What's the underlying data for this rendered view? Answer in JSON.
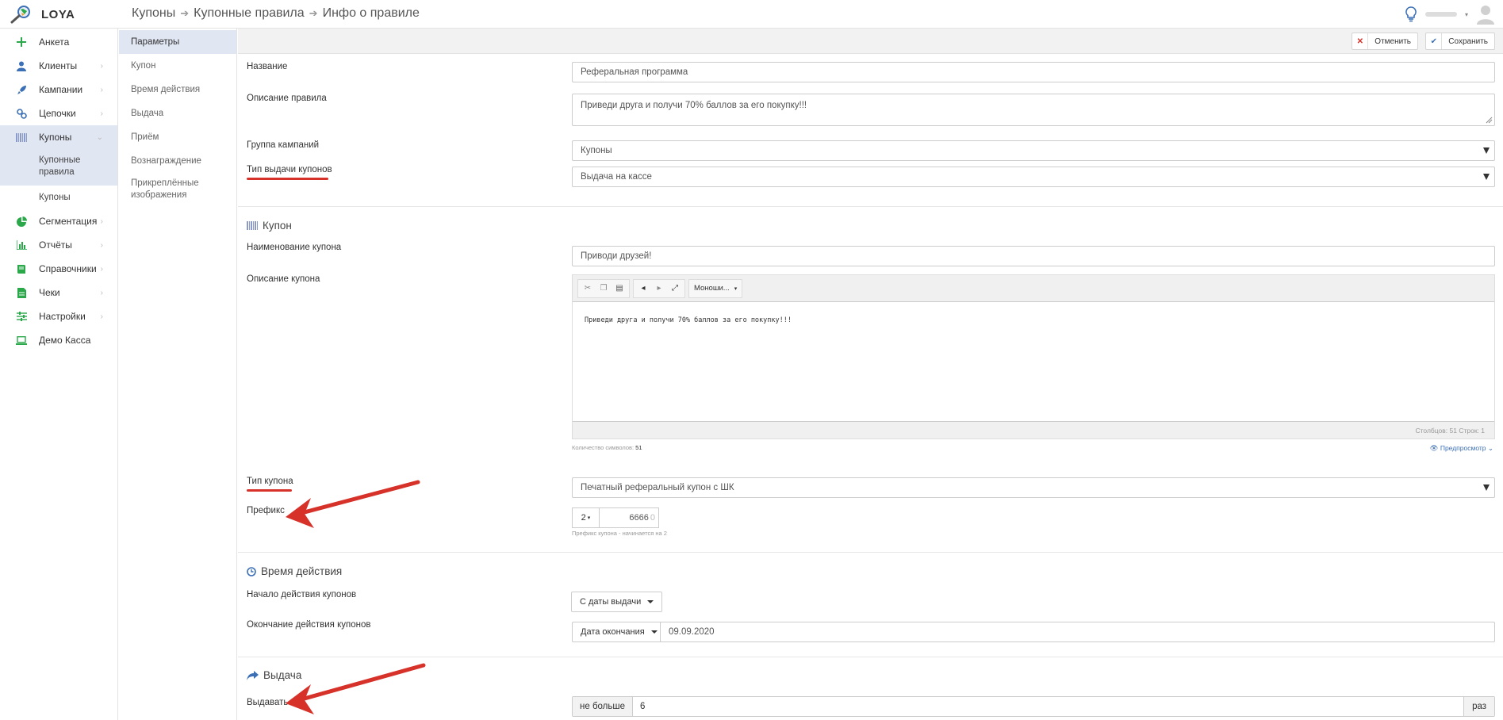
{
  "app": {
    "logo_text": "LOYA"
  },
  "breadcrumbs": [
    "Купоны",
    "Купонные правила",
    "Инфо о правиле"
  ],
  "sidebar": {
    "items": [
      {
        "label": "Анкета",
        "icon": "plus-icon",
        "color": "#2aa84a",
        "chevron": false
      },
      {
        "label": "Клиенты",
        "icon": "user-icon",
        "color": "#3b6fb6",
        "chevron": true
      },
      {
        "label": "Кампании",
        "icon": "rocket-icon",
        "color": "#3b6fb6",
        "chevron": true
      },
      {
        "label": "Цепочки",
        "icon": "chain-icon",
        "color": "#3b6fb6",
        "chevron": true
      },
      {
        "label": "Купоны",
        "icon": "barcode-icon",
        "color": "#8a9bc9",
        "chevron": true,
        "active": true
      },
      {
        "label": "Сегментация",
        "icon": "pie-icon",
        "color": "#2aa84a",
        "chevron": true
      },
      {
        "label": "Отчёты",
        "icon": "bar-chart-icon",
        "color": "#2aa84a",
        "chevron": true
      },
      {
        "label": "Справочники",
        "icon": "book-icon",
        "color": "#2aa84a",
        "chevron": true
      },
      {
        "label": "Чеки",
        "icon": "receipt-icon",
        "color": "#2aa84a",
        "chevron": true
      },
      {
        "label": "Настройки",
        "icon": "sliders-icon",
        "color": "#2aa84a",
        "chevron": true
      },
      {
        "label": "Демо Касса",
        "icon": "laptop-icon",
        "color": "#2aa84a",
        "chevron": false
      }
    ],
    "sub_items": [
      "Купонные правила",
      "Купоны"
    ]
  },
  "subnav": [
    "Параметры",
    "Купон",
    "Время действия",
    "Выдача",
    "Приём",
    "Вознаграждение",
    "Прикреплённые изображения"
  ],
  "actions": {
    "cancel": "Отменить",
    "save": "Сохранить"
  },
  "form": {
    "name_label": "Название",
    "name_value": "Реферальная программа",
    "desc_label": "Описание правила",
    "desc_value": "Приведи друга и получи 70% баллов за его покупку!!!",
    "group_label": "Группа кампаний",
    "group_value": "Купоны",
    "issue_type_label": "Тип выдачи купонов",
    "issue_type_value": "Выдача на кассе"
  },
  "coupon": {
    "section_title": "Купон",
    "name_label": "Наименование купона",
    "name_value": "Приводи друзей!",
    "desc_label": "Описание купона",
    "editor_font": "Моноши...",
    "editor_text": "Приведи друга и получи 70% баллов за его покупку!!!",
    "editor_status": "Столбцов: 51 Строк: 1",
    "char_count_label": "Количество символов:",
    "char_count": "51",
    "preview_link": "Предпросмотр",
    "type_label": "Тип купона",
    "type_value": "Печатный реферальный купон с ШК",
    "prefix_label": "Префикс",
    "prefix_select": "2",
    "prefix_value": "6666",
    "prefix_suffix": "0",
    "prefix_hint": "Префикс купона - начинается на 2"
  },
  "validity": {
    "section_title": "Время действия",
    "start_label": "Начало действия купонов",
    "start_value": "С даты выдачи",
    "end_label": "Окончание действия купонов",
    "end_select": "Дата окончания",
    "end_date": "09.09.2020"
  },
  "issue": {
    "section_title": "Выдача",
    "limit_label": "Выдавать",
    "limit_prefix": "не больше",
    "limit_value": "6",
    "limit_suffix": "раз"
  },
  "colors": {
    "accent_red": "#d6322a",
    "brand_blue": "#3b6fb6",
    "active_bg": "#e1e6f3"
  }
}
